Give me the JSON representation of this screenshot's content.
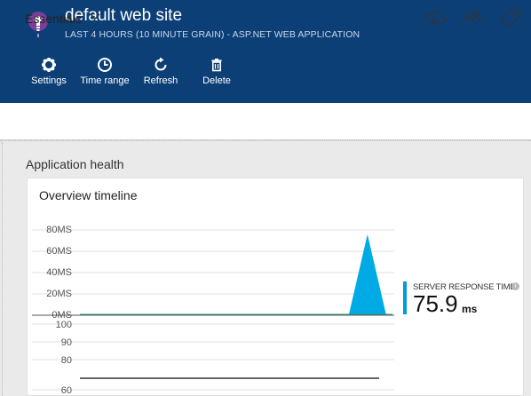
{
  "header": {
    "title": "default web site",
    "subtitle": "LAST 4 HOURS (10 MINUTE GRAIN) - ASP.NET WEB APPLICATION",
    "app_icon": "lightbulb-icon",
    "bg_color": "#0d3f77",
    "toolbar": [
      {
        "label": "Settings",
        "icon": "gear-icon"
      },
      {
        "label": "Time range",
        "icon": "clock-icon"
      },
      {
        "label": "Refresh",
        "icon": "refresh-icon"
      },
      {
        "label": "Delete",
        "icon": "trash-icon"
      }
    ]
  },
  "essentials": {
    "label": "Essentials",
    "icons": [
      "cloud-icon",
      "users-icon",
      "tag-icon"
    ]
  },
  "section": {
    "title": "Application health"
  },
  "tile": {
    "title": "Overview timeline",
    "metric": {
      "label": "SERVER RESPONSE TIME",
      "value": "75.9",
      "unit": "ms",
      "color": "#0099dd"
    }
  },
  "chart_data": [
    {
      "type": "area",
      "title": "",
      "y_ticks": [
        "80MS",
        "60MS",
        "40MS",
        "20MS",
        "0MS"
      ],
      "ylim": [
        0,
        80
      ],
      "series": [
        {
          "name": "SERVER RESPONSE TIME",
          "color": "#00aae4",
          "x": [
            0,
            0.86,
            0.92,
            0.98,
            1.0
          ],
          "values": [
            0,
            0,
            75.9,
            0,
            0
          ]
        }
      ],
      "grid": true
    },
    {
      "type": "line",
      "title": "",
      "y_ticks": [
        "100",
        "90",
        "80",
        "60"
      ],
      "ylim": [
        60,
        100
      ],
      "series": [],
      "grid": true
    }
  ]
}
